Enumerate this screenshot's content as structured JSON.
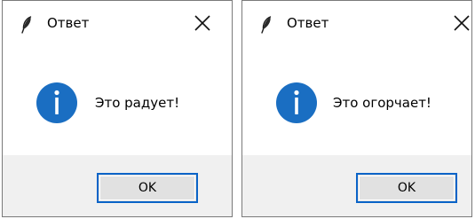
{
  "dialogs": [
    {
      "title": "Ответ",
      "app_icon": "feather-icon",
      "close_icon": "close-icon",
      "message_icon": "info-icon",
      "message": "Это радует!",
      "ok_label": "OK"
    },
    {
      "title": "Ответ",
      "app_icon": "feather-icon",
      "close_icon": "close-icon",
      "message_icon": "info-icon",
      "message": "Это огорчает!",
      "ok_label": "OK"
    }
  ],
  "colors": {
    "info_icon": "#1a6ec2",
    "button_border": "#0a64c8",
    "footer_background": "#f0f0f0"
  }
}
